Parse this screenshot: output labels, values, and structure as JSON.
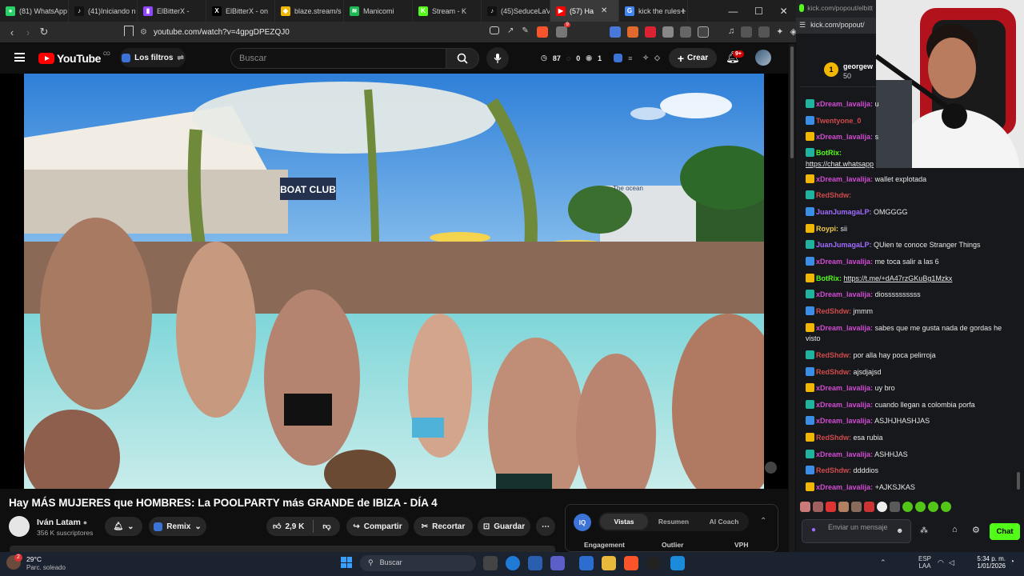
{
  "browser": {
    "tabs": [
      {
        "label": "(81) WhatsApp",
        "fav": "whatsapp-icon",
        "color": "#25d366",
        "glyph": "●"
      },
      {
        "label": "(41)Iniciando n",
        "fav": "tiktok-icon",
        "color": "#111111",
        "glyph": "♪"
      },
      {
        "label": "ElBitterX -",
        "fav": "twitch-icon",
        "color": "#9146ff",
        "glyph": "▮"
      },
      {
        "label": "ElBitterX - on",
        "fav": "x-icon",
        "color": "#000000",
        "glyph": "X"
      },
      {
        "label": "blaze.stream/s",
        "fav": "blaze-icon",
        "color": "#f2b705",
        "glyph": "◆"
      },
      {
        "label": "Manicomi",
        "fav": "spotify-icon",
        "color": "#1db954",
        "glyph": "≋"
      },
      {
        "label": "Stream - K",
        "fav": "kick-icon",
        "color": "#53fc18",
        "glyph": "K"
      },
      {
        "label": "(45)SeduceLaV",
        "fav": "tiktok-icon",
        "color": "#111111",
        "glyph": "♪"
      },
      {
        "label": "(57) Ha",
        "fav": "youtube-icon",
        "color": "#ff0000",
        "glyph": "▶"
      },
      {
        "label": "kick the rules t",
        "fav": "google-icon",
        "color": "#4285f4",
        "glyph": "G"
      }
    ],
    "url": "youtube.com/watch?v=4gpgDPEZQJ0",
    "notif_badge": "9"
  },
  "youtube": {
    "logo": "YouTube",
    "logo_sup": "CO",
    "filters_label": "Los filtros",
    "search_placeholder": "Buscar",
    "stats": {
      "views": "87",
      "a": "0",
      "b": "1"
    },
    "create_label": "Crear",
    "notif_count": "9+",
    "video_title": "Hay MÁS MUJERES que HOMBRES: La POOLPARTY más GRANDE de IBIZA - DÍA 4",
    "channel_name": "Iván Latam",
    "subscribers": "356 K suscriptores",
    "remix_label": "Remix",
    "likes": "2,9 K",
    "share_label": "Compartir",
    "clip_label": "Recortar",
    "save_label": "Guardar",
    "analytics": {
      "tabs": [
        "Vistas",
        "Resumen",
        "AI Coach"
      ],
      "cols": [
        "Engagement",
        "Outlier",
        "VPH"
      ]
    },
    "video_scene": {
      "boat_club_sign": "BOAT CLUB",
      "ocean_sign": "The ocean"
    }
  },
  "chat": {
    "url": "kick.com/popout/elbitt",
    "url_full": "kick.com/popout/",
    "top_user": "georgew",
    "top_amount": "50",
    "messages": [
      {
        "user": "xDream_lavalija:",
        "color": "#d24bd2",
        "text": "u"
      },
      {
        "user": "Twentyone_0",
        "color": "#d24b4b",
        "text": ""
      },
      {
        "user": "xDream_lavalija:",
        "color": "#d24bd2",
        "text": "s"
      },
      {
        "user": "BotRix:",
        "color": "#53fc18",
        "text": ""
      },
      {
        "user": "",
        "color": "#e8e8e8",
        "text": "https://chat.whatsapp"
      },
      {
        "user": "xDream_lavalija:",
        "color": "#d24bd2",
        "text": "wallet explotada"
      },
      {
        "user": "RedShdw:",
        "color": "#d24b4b",
        "text": ""
      },
      {
        "user": "JuanJumagaLP:",
        "color": "#a06bff",
        "text": "OMGGGG"
      },
      {
        "user": "Roypi:",
        "color": "#f2c94c",
        "text": "sii"
      },
      {
        "user": "JuanJumagaLP:",
        "color": "#a06bff",
        "text": "QUien te conoce Stranger Things"
      },
      {
        "user": "xDream_lavalija:",
        "color": "#d24bd2",
        "text": "me toca salir a las 6"
      },
      {
        "user": "BotRix:",
        "color": "#53fc18",
        "text": "https://t.me/+dA47rzGKuBg1Mzkx"
      },
      {
        "user": "xDream_lavalija:",
        "color": "#d24bd2",
        "text": "diossssssssss"
      },
      {
        "user": "RedShdw:",
        "color": "#d24b4b",
        "text": "jmmm"
      },
      {
        "user": "xDream_lavalija:",
        "color": "#d24bd2",
        "text": "sabes que me gusta nada de gordas he visto"
      },
      {
        "user": "RedShdw:",
        "color": "#d24b4b",
        "text": "por alla hay poca pelirroja"
      },
      {
        "user": "RedShdw:",
        "color": "#d24b4b",
        "text": "ajsdjajsd"
      },
      {
        "user": "xDream_lavalija:",
        "color": "#d24bd2",
        "text": "uy bro"
      },
      {
        "user": "xDream_lavalija:",
        "color": "#d24bd2",
        "text": "cuando llegan a colombia porfa"
      },
      {
        "user": "xDream_lavalija:",
        "color": "#d24bd2",
        "text": "ASJHJHASHJAS"
      },
      {
        "user": "RedShdw:",
        "color": "#d24b4b",
        "text": "esa rubia"
      },
      {
        "user": "xDream_lavalija:",
        "color": "#d24bd2",
        "text": "ASHHJAS"
      },
      {
        "user": "RedShdw:",
        "color": "#d24b4b",
        "text": "ddddios"
      },
      {
        "user": "xDream_lavalija:",
        "color": "#d24bd2",
        "text": "+AJKSJKAS"
      }
    ],
    "input_placeholder": "Enviar un mensaje",
    "chat_button": "Chat"
  },
  "taskbar": {
    "weather_temp": "29°C",
    "weather_desc": "Parc. soleado",
    "search_label": "Buscar",
    "lang_top": "ESP",
    "lang_bottom": "LAA",
    "time": "5:34 p. m.",
    "date": "1/01/2026",
    "notif": "2"
  }
}
